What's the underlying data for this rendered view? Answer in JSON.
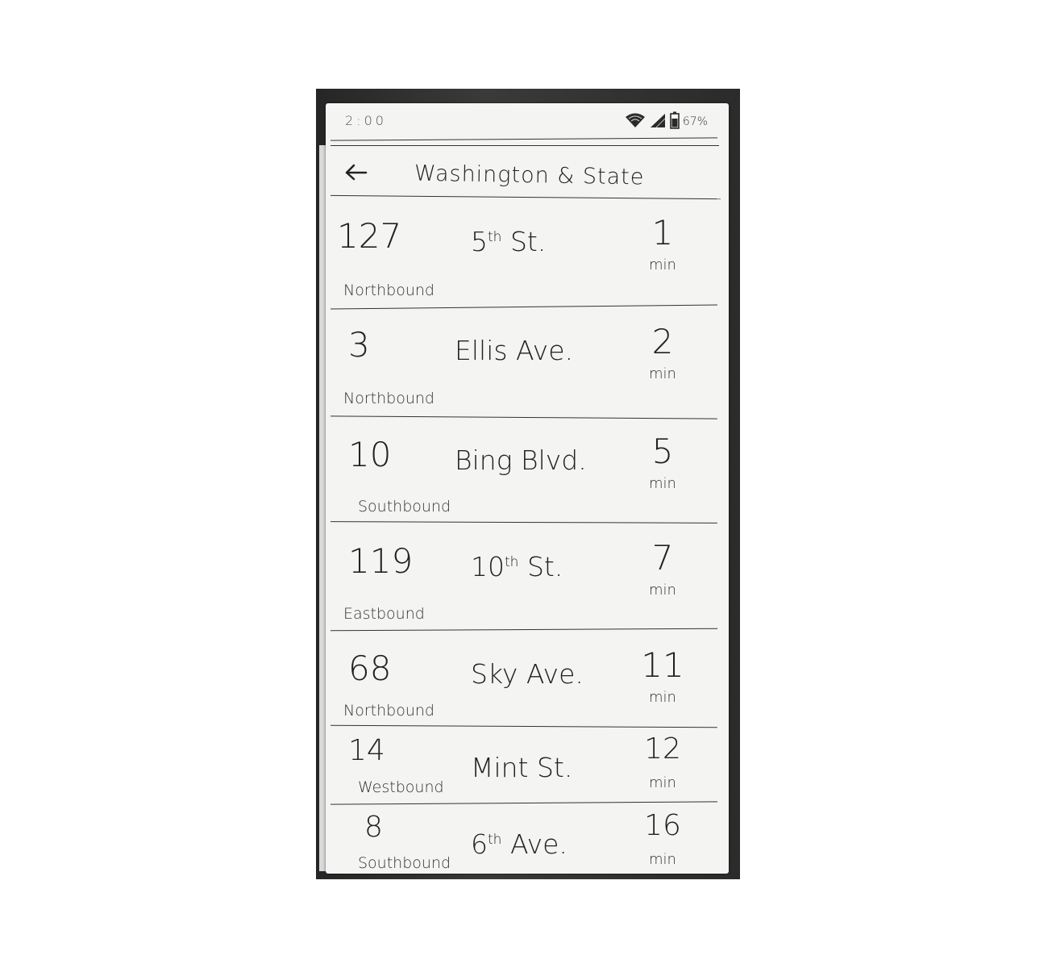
{
  "status_bar": {
    "time": "2:00",
    "battery": "67%",
    "icons": [
      "wifi-icon",
      "cell-signal-icon",
      "battery-icon"
    ]
  },
  "header": {
    "title": "Washington & State",
    "back_icon": "back-arrow-icon"
  },
  "arrivals": [
    {
      "route": "127",
      "street": "5th St.",
      "street_base": "5",
      "street_sup": "th",
      "street_rest": " St.",
      "direction": "Northbound",
      "minutes": "1",
      "unit": "min"
    },
    {
      "route": "3",
      "street": "Ellis Ave.",
      "street_base": "Ellis Ave.",
      "street_sup": "",
      "street_rest": "",
      "direction": "Northbound",
      "minutes": "2",
      "unit": "min"
    },
    {
      "route": "10",
      "street": "Bing Blvd.",
      "street_base": "Bing Blvd.",
      "street_sup": "",
      "street_rest": "",
      "direction": "Southbound",
      "minutes": "5",
      "unit": "min"
    },
    {
      "route": "119",
      "street": "10th St.",
      "street_base": "10",
      "street_sup": "th",
      "street_rest": " St.",
      "direction": "Eastbound",
      "minutes": "7",
      "unit": "min"
    },
    {
      "route": "68",
      "street": "Sky Ave.",
      "street_base": "Sky Ave.",
      "street_sup": "",
      "street_rest": "",
      "direction": "Northbound",
      "minutes": "11",
      "unit": "min"
    },
    {
      "route": "14",
      "street": "Mint St.",
      "street_base": "Mint St.",
      "street_sup": "",
      "street_rest": "",
      "direction": "Westbound",
      "minutes": "12",
      "unit": "min"
    },
    {
      "route": "8",
      "street": "6th Ave.",
      "street_base": "6",
      "street_sup": "th",
      "street_rest": " Ave.",
      "direction": "Southbound",
      "minutes": "16",
      "unit": "min"
    }
  ]
}
